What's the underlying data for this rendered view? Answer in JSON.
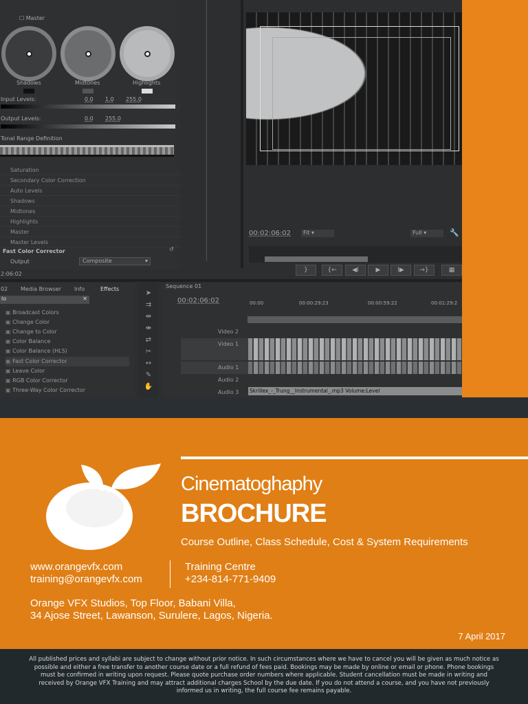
{
  "editor": {
    "color_corrector": {
      "master_label": "Master",
      "wheels": [
        "Shadows",
        "Midtones",
        "Highlights"
      ],
      "input_levels_label": "Input Levels:",
      "input_levels": [
        "0.0",
        "1.0",
        "255.0"
      ],
      "output_levels_label": "Output Levels:",
      "output_levels": [
        "0.0",
        "255.0"
      ],
      "tonal_range_label": "Tonal Range Definition",
      "sections": [
        "Saturation",
        "Secondary Color Correction",
        "Auto Levels",
        "Shadows",
        "Midtones",
        "Highlights",
        "Master",
        "Master Levels"
      ],
      "effect_name": "Fast Color Corrector",
      "output_label": "Output",
      "output_value": "Composite",
      "timecode": "2:06:02"
    },
    "program_monitor": {
      "timecode": "00:02:06:02",
      "zoom_value": "Fit",
      "quality_value": "Full"
    },
    "effects_panel": {
      "tabs": [
        "02",
        "Media Browser",
        "Info",
        "Effects"
      ],
      "search_value": "lo",
      "items": [
        "Broadcast Colors",
        "Change Color",
        "Change to Color",
        "Color Balance",
        "Color Balance (HLS)",
        "Fast Color Corrector",
        "Leave Color",
        "RGB Color Corrector",
        "Three-Way Color Corrector"
      ]
    },
    "sequence": {
      "tab": "Sequence 01",
      "timecode": "00:02:06:02",
      "ruler": [
        "00:00",
        "00:00:29:23",
        "00:00:59:22",
        "00:01:29:2"
      ],
      "tracks": [
        "Video 2",
        "Video 1",
        "Audio 1",
        "Audio 2",
        "Audio 3"
      ],
      "audio_clip": "Skrillex_-_Trung__Instrumental_.mp3  Volume:Level"
    }
  },
  "brochure": {
    "title": "Cinematoghaphy",
    "heading": "BROCHURE",
    "subtitle": "Course Outline, Class Schedule, Cost & System Requirements",
    "website": "www.orangevfx.com",
    "email": "training@orangevfx.com",
    "centre_label": "Training Centre",
    "phone": "+234-814-771-9409",
    "address_line1": "Orange VFX Studios, Top Floor, Babani Villa,",
    "address_line2": "34 Ajose Street, Lawanson, Surulere, Lagos, Nigeria.",
    "date": "7 April 2017",
    "disclaimer": "All published prices and syllabi are subject to change without prior notice. In such circumstances where we have to cancel you will be given as much notice as possible and either a free transfer to another course date or a full refund of fees paid. Bookings may be made by online or email or phone. Phone bookings must be confirmed in writing upon request. Please quote purchase order numbers where applicable. Student cancellation must be made in writing and received by Orange VFX Training and may attract additional charges School by the due date. If you do not attend a course, and you have not previously informed us in writing, the full course fee remains payable."
  },
  "colors": {
    "orange": "#e07f16",
    "dark": "#22292d"
  }
}
